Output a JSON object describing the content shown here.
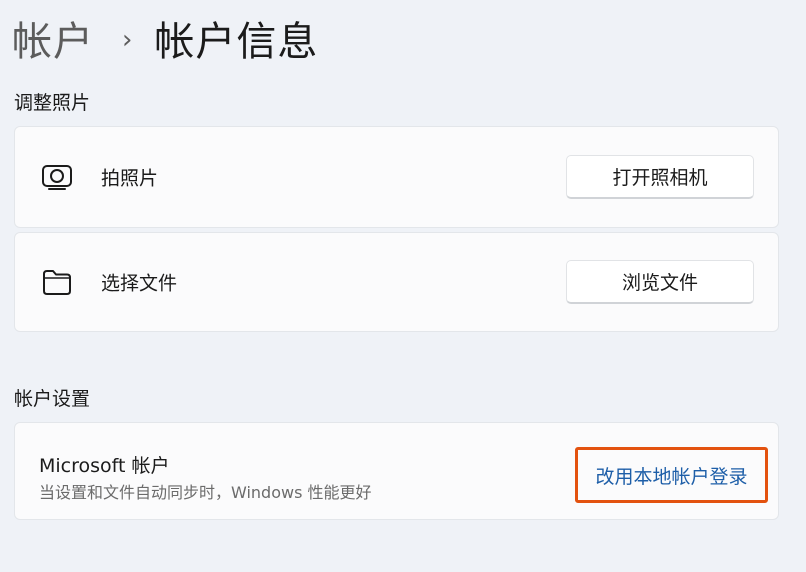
{
  "breadcrumb": {
    "parent": "帐户",
    "separator": "›",
    "current": "帐户信息"
  },
  "adjust_photo": {
    "section_title": "调整照片",
    "take_photo": {
      "icon": "camera-icon",
      "label": "拍照片",
      "button_label": "打开照相机"
    },
    "choose_file": {
      "icon": "folder-icon",
      "label": "选择文件",
      "button_label": "浏览文件"
    }
  },
  "account_settings": {
    "section_title": "帐户设置",
    "microsoft_account": {
      "title": "Microsoft 帐户",
      "subtitle": "当设置和文件自动同步时，Windows 性能更好",
      "link_label": "改用本地帐户登录",
      "highlight_color": "#e3520f",
      "link_color": "#1d5ea8"
    }
  }
}
